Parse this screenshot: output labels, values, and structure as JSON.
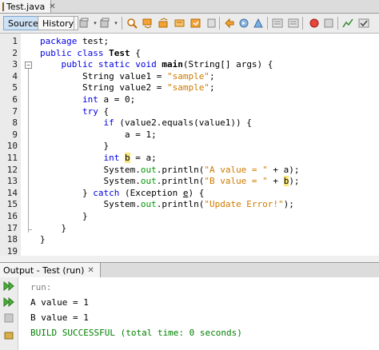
{
  "file_tab": {
    "label": "Test.java"
  },
  "toolbar": {
    "source_label": "Source",
    "history_label": "History"
  },
  "editor": {
    "line_numbers": [
      "1",
      "2",
      "3",
      "4",
      "5",
      "6",
      "7",
      "8",
      "9",
      "10",
      "11",
      "12",
      "13",
      "14",
      "15",
      "16",
      "17",
      "18",
      "19"
    ],
    "lines": [
      {
        "segs": [
          [
            "kw",
            "package"
          ],
          [
            "p",
            " test;"
          ]
        ]
      },
      {
        "segs": [
          [
            "kw",
            "public class"
          ],
          [
            "p",
            " "
          ],
          [
            "bold",
            "Test"
          ],
          [
            "p",
            " {"
          ]
        ]
      },
      {
        "segs": [
          [
            "p",
            "    "
          ],
          [
            "kw",
            "public static void"
          ],
          [
            "p",
            " "
          ],
          [
            "bold",
            "main"
          ],
          [
            "p",
            "(String[] args) {"
          ]
        ]
      },
      {
        "segs": [
          [
            "p",
            "        String value1 = "
          ],
          [
            "str",
            "\"sample\""
          ],
          [
            "p",
            ";"
          ]
        ]
      },
      {
        "segs": [
          [
            "p",
            "        String value2 = "
          ],
          [
            "str",
            "\"sample\""
          ],
          [
            "p",
            ";"
          ]
        ]
      },
      {
        "segs": [
          [
            "p",
            "        "
          ],
          [
            "kw",
            "int"
          ],
          [
            "p",
            " a = 0;"
          ]
        ]
      },
      {
        "segs": [
          [
            "p",
            "        "
          ],
          [
            "kw",
            "try"
          ],
          [
            "p",
            " {"
          ]
        ]
      },
      {
        "segs": [
          [
            "p",
            "            "
          ],
          [
            "kw",
            "if"
          ],
          [
            "p",
            " (value2.equals(value1)) {"
          ]
        ]
      },
      {
        "segs": [
          [
            "p",
            "                a = 1;"
          ]
        ]
      },
      {
        "segs": [
          [
            "p",
            "            }"
          ]
        ]
      },
      {
        "segs": [
          [
            "p",
            "            "
          ],
          [
            "kw",
            "int"
          ],
          [
            "p",
            " "
          ],
          [
            "hl",
            "b"
          ],
          [
            "p",
            " = a;"
          ]
        ]
      },
      {
        "segs": [
          [
            "p",
            "            System."
          ],
          [
            "fld",
            "out"
          ],
          [
            "p",
            ".println("
          ],
          [
            "str",
            "\"A value = \""
          ],
          [
            "p",
            " + a);"
          ]
        ]
      },
      {
        "segs": [
          [
            "p",
            "            System."
          ],
          [
            "fld",
            "out"
          ],
          [
            "p",
            ".println("
          ],
          [
            "str",
            "\"B value = \""
          ],
          [
            "p",
            " + "
          ],
          [
            "hl",
            "b"
          ],
          [
            "p",
            ");"
          ]
        ]
      },
      {
        "segs": [
          [
            "p",
            "        } "
          ],
          [
            "kw",
            "catch"
          ],
          [
            "p",
            " (Exception "
          ],
          [
            "ul",
            "e"
          ],
          [
            "p",
            ") {"
          ]
        ]
      },
      {
        "segs": [
          [
            "p",
            "            System."
          ],
          [
            "fld",
            "out"
          ],
          [
            "p",
            ".println("
          ],
          [
            "str",
            "\"Update Error!\""
          ],
          [
            "p",
            ");"
          ]
        ]
      },
      {
        "segs": [
          [
            "p",
            "        }"
          ]
        ]
      },
      {
        "segs": [
          [
            "p",
            "    }"
          ]
        ]
      },
      {
        "segs": [
          [
            "p",
            "}"
          ]
        ]
      },
      {
        "segs": []
      }
    ]
  },
  "output": {
    "title": "Output - Test (run)",
    "lines": [
      "run:",
      "A value = 1",
      "B value = 1",
      "BUILD SUCCESSFUL (total time: 0 seconds)"
    ],
    "colors": {
      "run": "#808080",
      "text": "#000000",
      "success": "#008000"
    }
  },
  "colors": {
    "keyword": "#0000e6",
    "string": "#ce7b00",
    "field": "#009900",
    "highlight": "#f7e67a"
  }
}
